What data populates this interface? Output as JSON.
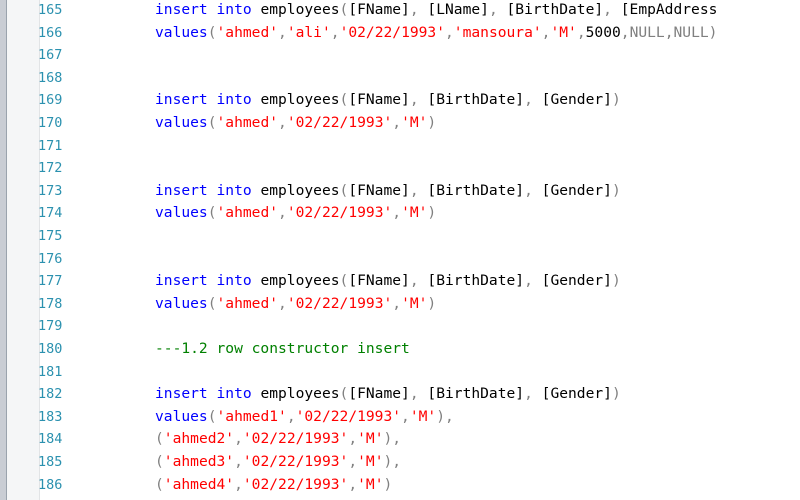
{
  "colors": {
    "keyword": "#0000ff",
    "string": "#ff0000",
    "operator": "#808080",
    "comment": "#008000",
    "identifier": "#000000",
    "line_number": "#2b91af"
  },
  "lines": [
    {
      "n": "165",
      "tokens": [
        {
          "t": "kw",
          "v": "insert into"
        },
        {
          "t": "txt",
          "v": " employees"
        },
        {
          "t": "gray",
          "v": "("
        },
        {
          "t": "txt",
          "v": "[FName]"
        },
        {
          "t": "gray",
          "v": ","
        },
        {
          "t": "txt",
          "v": " [LName]"
        },
        {
          "t": "gray",
          "v": ","
        },
        {
          "t": "txt",
          "v": " [BirthDate]"
        },
        {
          "t": "gray",
          "v": ","
        },
        {
          "t": "txt",
          "v": " [EmpAddress"
        }
      ]
    },
    {
      "n": "166",
      "tokens": [
        {
          "t": "kw",
          "v": "values"
        },
        {
          "t": "gray",
          "v": "("
        },
        {
          "t": "str",
          "v": "'ahmed'"
        },
        {
          "t": "gray",
          "v": ","
        },
        {
          "t": "str",
          "v": "'ali'"
        },
        {
          "t": "gray",
          "v": ","
        },
        {
          "t": "str",
          "v": "'02/22/1993'"
        },
        {
          "t": "gray",
          "v": ","
        },
        {
          "t": "str",
          "v": "'mansoura'"
        },
        {
          "t": "gray",
          "v": ","
        },
        {
          "t": "str",
          "v": "'M'"
        },
        {
          "t": "gray",
          "v": ","
        },
        {
          "t": "txt",
          "v": "5000"
        },
        {
          "t": "gray",
          "v": ",NULL,NULL)"
        }
      ]
    },
    {
      "n": "167",
      "tokens": []
    },
    {
      "n": "168",
      "tokens": []
    },
    {
      "n": "169",
      "tokens": [
        {
          "t": "kw",
          "v": "insert into"
        },
        {
          "t": "txt",
          "v": " employees"
        },
        {
          "t": "gray",
          "v": "("
        },
        {
          "t": "txt",
          "v": "[FName]"
        },
        {
          "t": "gray",
          "v": ","
        },
        {
          "t": "txt",
          "v": " [BirthDate]"
        },
        {
          "t": "gray",
          "v": ","
        },
        {
          "t": "txt",
          "v": " [Gender]"
        },
        {
          "t": "gray",
          "v": ")"
        }
      ]
    },
    {
      "n": "170",
      "tokens": [
        {
          "t": "kw",
          "v": "values"
        },
        {
          "t": "gray",
          "v": "("
        },
        {
          "t": "str",
          "v": "'ahmed'"
        },
        {
          "t": "gray",
          "v": ","
        },
        {
          "t": "str",
          "v": "'02/22/1993'"
        },
        {
          "t": "gray",
          "v": ","
        },
        {
          "t": "str",
          "v": "'M'"
        },
        {
          "t": "gray",
          "v": ")"
        }
      ]
    },
    {
      "n": "171",
      "tokens": []
    },
    {
      "n": "172",
      "tokens": []
    },
    {
      "n": "173",
      "tokens": [
        {
          "t": "kw",
          "v": "insert into"
        },
        {
          "t": "txt",
          "v": " employees"
        },
        {
          "t": "gray",
          "v": "("
        },
        {
          "t": "txt",
          "v": "[FName]"
        },
        {
          "t": "gray",
          "v": ","
        },
        {
          "t": "txt",
          "v": " [BirthDate]"
        },
        {
          "t": "gray",
          "v": ","
        },
        {
          "t": "txt",
          "v": " [Gender]"
        },
        {
          "t": "gray",
          "v": ")"
        }
      ]
    },
    {
      "n": "174",
      "tokens": [
        {
          "t": "kw",
          "v": "values"
        },
        {
          "t": "gray",
          "v": "("
        },
        {
          "t": "str",
          "v": "'ahmed'"
        },
        {
          "t": "gray",
          "v": ","
        },
        {
          "t": "str",
          "v": "'02/22/1993'"
        },
        {
          "t": "gray",
          "v": ","
        },
        {
          "t": "str",
          "v": "'M'"
        },
        {
          "t": "gray",
          "v": ")"
        }
      ]
    },
    {
      "n": "175",
      "tokens": []
    },
    {
      "n": "176",
      "tokens": []
    },
    {
      "n": "177",
      "tokens": [
        {
          "t": "kw",
          "v": "insert into"
        },
        {
          "t": "txt",
          "v": " employees"
        },
        {
          "t": "gray",
          "v": "("
        },
        {
          "t": "txt",
          "v": "[FName]"
        },
        {
          "t": "gray",
          "v": ","
        },
        {
          "t": "txt",
          "v": " [BirthDate]"
        },
        {
          "t": "gray",
          "v": ","
        },
        {
          "t": "txt",
          "v": " [Gender]"
        },
        {
          "t": "gray",
          "v": ")"
        }
      ]
    },
    {
      "n": "178",
      "tokens": [
        {
          "t": "kw",
          "v": "values"
        },
        {
          "t": "gray",
          "v": "("
        },
        {
          "t": "str",
          "v": "'ahmed'"
        },
        {
          "t": "gray",
          "v": ","
        },
        {
          "t": "str",
          "v": "'02/22/1993'"
        },
        {
          "t": "gray",
          "v": ","
        },
        {
          "t": "str",
          "v": "'M'"
        },
        {
          "t": "gray",
          "v": ")"
        }
      ]
    },
    {
      "n": "179",
      "tokens": []
    },
    {
      "n": "180",
      "tokens": [
        {
          "t": "cmt",
          "v": "---1.2 row constructor insert"
        }
      ]
    },
    {
      "n": "181",
      "tokens": []
    },
    {
      "n": "182",
      "tokens": [
        {
          "t": "kw",
          "v": "insert into"
        },
        {
          "t": "txt",
          "v": " employees"
        },
        {
          "t": "gray",
          "v": "("
        },
        {
          "t": "txt",
          "v": "[FName]"
        },
        {
          "t": "gray",
          "v": ","
        },
        {
          "t": "txt",
          "v": " [BirthDate]"
        },
        {
          "t": "gray",
          "v": ","
        },
        {
          "t": "txt",
          "v": " [Gender]"
        },
        {
          "t": "gray",
          "v": ")"
        }
      ]
    },
    {
      "n": "183",
      "tokens": [
        {
          "t": "kw",
          "v": "values"
        },
        {
          "t": "gray",
          "v": "("
        },
        {
          "t": "str",
          "v": "'ahmed1'"
        },
        {
          "t": "gray",
          "v": ","
        },
        {
          "t": "str",
          "v": "'02/22/1993'"
        },
        {
          "t": "gray",
          "v": ","
        },
        {
          "t": "str",
          "v": "'M'"
        },
        {
          "t": "gray",
          "v": "),"
        }
      ]
    },
    {
      "n": "184",
      "tokens": [
        {
          "t": "gray",
          "v": "("
        },
        {
          "t": "str",
          "v": "'ahmed2'"
        },
        {
          "t": "gray",
          "v": ","
        },
        {
          "t": "str",
          "v": "'02/22/1993'"
        },
        {
          "t": "gray",
          "v": ","
        },
        {
          "t": "str",
          "v": "'M'"
        },
        {
          "t": "gray",
          "v": "),"
        }
      ]
    },
    {
      "n": "185",
      "tokens": [
        {
          "t": "gray",
          "v": "("
        },
        {
          "t": "str",
          "v": "'ahmed3'"
        },
        {
          "t": "gray",
          "v": ","
        },
        {
          "t": "str",
          "v": "'02/22/1993'"
        },
        {
          "t": "gray",
          "v": ","
        },
        {
          "t": "str",
          "v": "'M'"
        },
        {
          "t": "gray",
          "v": "),"
        }
      ]
    },
    {
      "n": "186",
      "tokens": [
        {
          "t": "gray",
          "v": "("
        },
        {
          "t": "str",
          "v": "'ahmed4'"
        },
        {
          "t": "gray",
          "v": ","
        },
        {
          "t": "str",
          "v": "'02/22/1993'"
        },
        {
          "t": "gray",
          "v": ","
        },
        {
          "t": "str",
          "v": "'M'"
        },
        {
          "t": "gray",
          "v": ")"
        }
      ]
    }
  ]
}
